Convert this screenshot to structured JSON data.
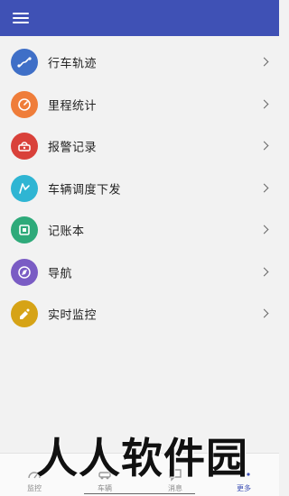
{
  "menu": {
    "items": [
      {
        "label": "行车轨迹",
        "icon": "route-icon",
        "color": "#3f6fc7"
      },
      {
        "label": "里程统计",
        "icon": "mileage-icon",
        "color": "#ef7d3a"
      },
      {
        "label": "报警记录",
        "icon": "alarm-icon",
        "color": "#d9413a"
      },
      {
        "label": "车辆调度下发",
        "icon": "dispatch-icon",
        "color": "#2fb5d3"
      },
      {
        "label": "记账本",
        "icon": "ledger-icon",
        "color": "#2eaa7a"
      },
      {
        "label": "导航",
        "icon": "navigation-icon",
        "color": "#7a5cc4"
      },
      {
        "label": "实时监控",
        "icon": "monitor-icon",
        "color": "#d6a316"
      }
    ]
  },
  "tabs": [
    {
      "label": "监控",
      "icon": "monitor-tab-icon"
    },
    {
      "label": "车辆",
      "icon": "vehicle-tab-icon"
    },
    {
      "label": "消息",
      "icon": "message-tab-icon"
    },
    {
      "label": "更多",
      "icon": "more-tab-icon",
      "active": true
    }
  ],
  "watermark": {
    "text": "人人软件园"
  },
  "colors": {
    "appbar": "#3f51b5",
    "background": "#f2f2f2",
    "active_tab": "#3f51b5"
  }
}
